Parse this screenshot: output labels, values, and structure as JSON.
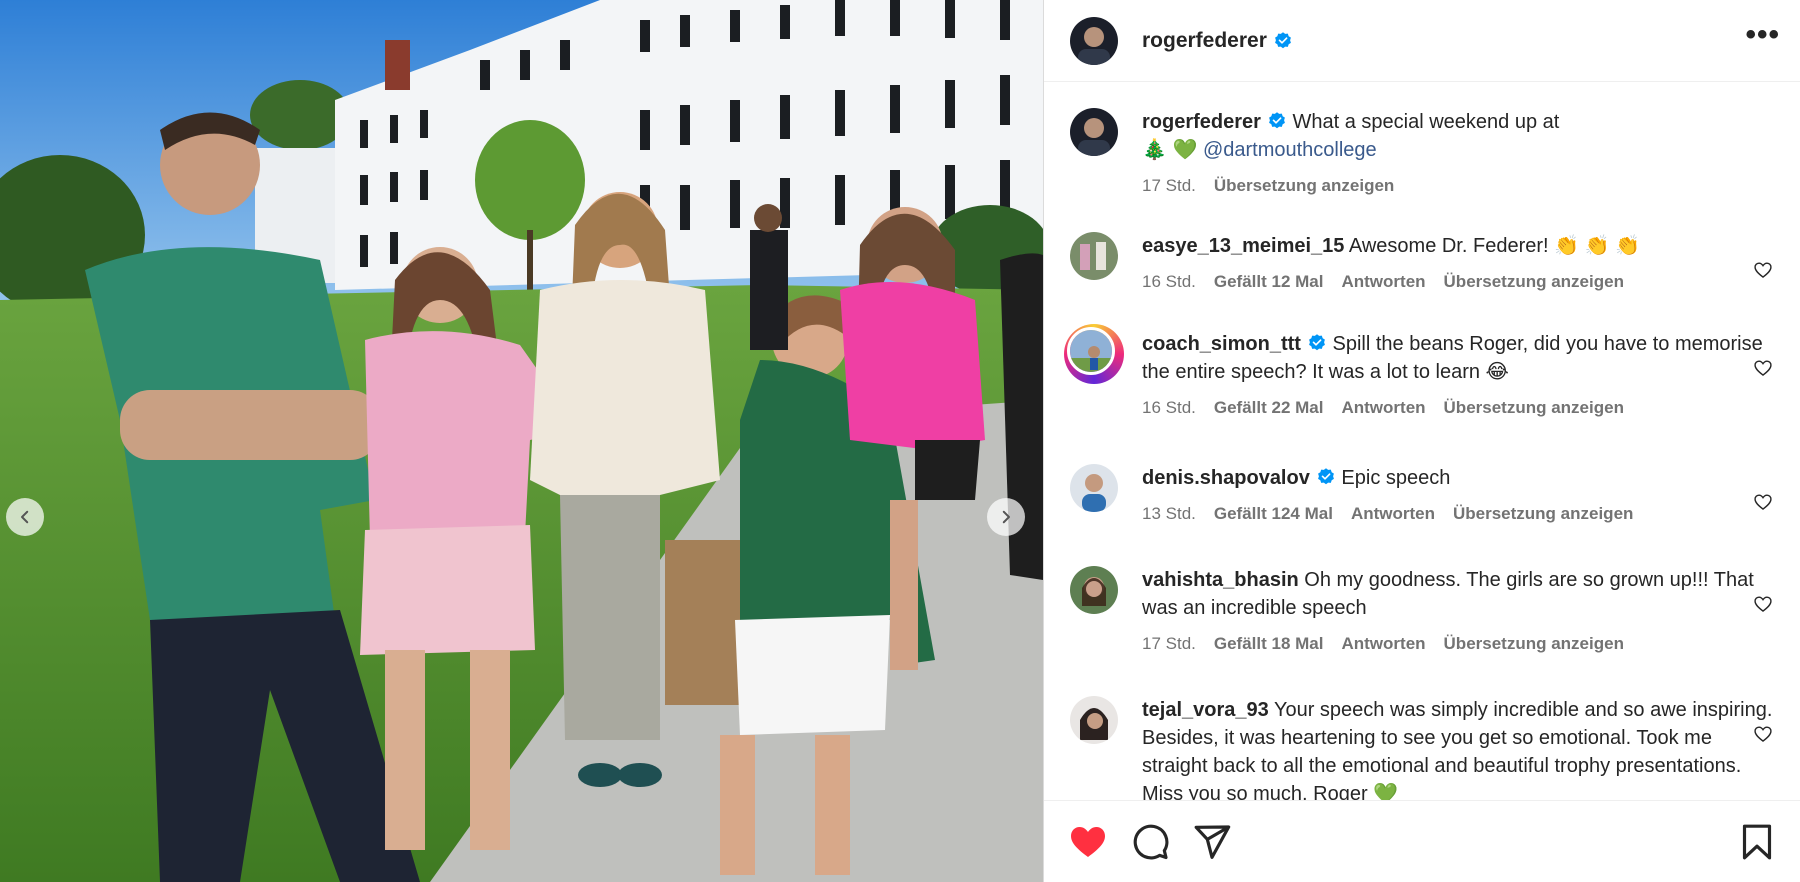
{
  "post": {
    "username": "rogerfederer",
    "more_label": "•••",
    "caption": {
      "username": "rogerfederer",
      "text": "What a special weekend up at",
      "emoji": "🎄 💚",
      "mention": "@dartmouthcollege",
      "time": "17 Std.",
      "translate": "Übersetzung anzeigen"
    }
  },
  "comments": [
    {
      "username": "easye_13_meimei_15",
      "verified": false,
      "text": "Awesome Dr. Federer! 👏 👏 👏",
      "time": "16 Std.",
      "likes": "Gefällt 12 Mal",
      "reply": "Antworten",
      "translate": "Übersetzung anzeigen"
    },
    {
      "username": "coach_simon_ttt",
      "verified": true,
      "text": "Spill the beans Roger, did you have to memorise the entire speech? It was a lot to learn 😂",
      "time": "16 Std.",
      "likes": "Gefällt 22 Mal",
      "reply": "Antworten",
      "translate": "Übersetzung anzeigen"
    },
    {
      "username": "denis.shapovalov",
      "verified": true,
      "text": "Epic speech",
      "time": "13 Std.",
      "likes": "Gefällt 124 Mal",
      "reply": "Antworten",
      "translate": "Übersetzung anzeigen"
    },
    {
      "username": "vahishta_bhasin",
      "verified": false,
      "text": "Oh my goodness. The girls are so grown up!!! That was an incredible speech",
      "time": "17 Std.",
      "likes": "Gefällt 18 Mal",
      "reply": "Antworten",
      "translate": "Übersetzung anzeigen"
    },
    {
      "username": "tejal_vora_93",
      "verified": false,
      "text": "Your speech was simply incredible and so awe inspiring. Besides, it was heartening to see you get so emotional. Took me straight back to all the emotional and beautiful trophy presentations. Miss you so much, Roger 💚"
    }
  ],
  "icons": {
    "like": "heart-filled-icon",
    "comment": "comment-bubble-icon",
    "share": "paper-plane-icon",
    "save": "bookmark-icon",
    "prev": "chevron-left-icon",
    "next": "chevron-right-icon"
  },
  "colors": {
    "like_red": "#ff3040",
    "verified_blue": "#0095f6",
    "meta_gray": "#737373"
  }
}
